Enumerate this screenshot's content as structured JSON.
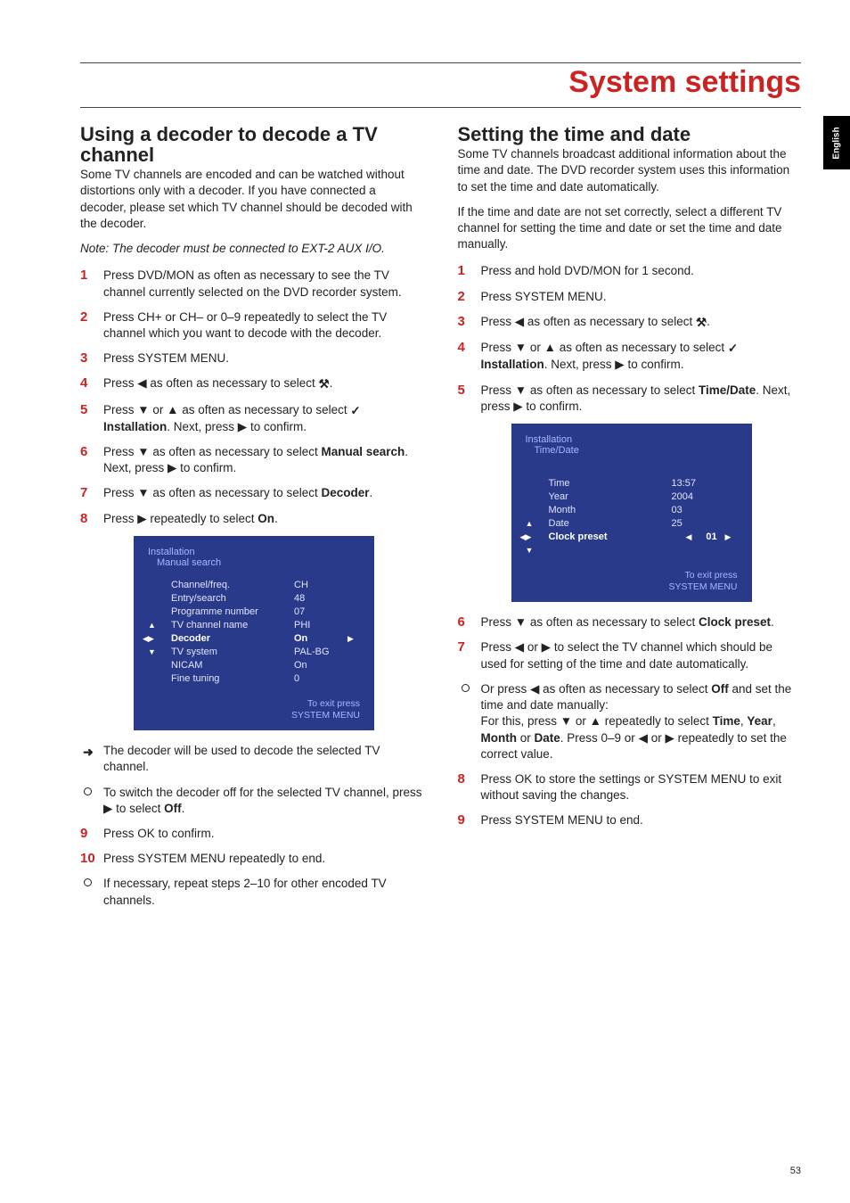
{
  "page": {
    "title": "System settings",
    "language_tab": "English",
    "page_number": "53"
  },
  "glyphs": {
    "left": "◀",
    "right": "▶",
    "up": "▲",
    "down": "▼",
    "arrow_result": "➜",
    "tool": "⚒",
    "wrench": "✓"
  },
  "left": {
    "title": "Using a decoder to decode a TV channel",
    "intro": "Some TV channels are encoded and can be watched without distortions only with a decoder. If you have connected a decoder, please set which TV channel should be decoded with the decoder.",
    "note": "Note: The decoder must be connected to EXT-2 AUX I/O.",
    "steps": {
      "s1": "Press DVD/MON as often as necessary to see the TV channel currently selected on the DVD recorder system.",
      "s2": "Press CH+ or CH– or 0–9 repeatedly to select the TV channel which you want to decode with the decoder.",
      "s3": "Press SYSTEM MENU.",
      "s4a": "Press ",
      "s4b": " as often as necessary to select ",
      "s4c": ".",
      "s5a": "Press ",
      "s5b": " or ",
      "s5c": " as often as necessary to select ",
      "s5d_bold": "Installation",
      "s5e": ". Next, press ",
      "s5f": " to confirm.",
      "s6a": "Press ",
      "s6b": " as often as necessary to select ",
      "s6c_bold": "Manual search",
      "s6d": ". Next, press ",
      "s6e": " to confirm.",
      "s7a": "Press ",
      "s7b": " as often as necessary to select ",
      "s7c_bold": "Decoder",
      "s7d": ".",
      "s8a": "Press ",
      "s8b": " repeatedly to select ",
      "s8c_bold": "On",
      "s8d": ".",
      "s9": "Press OK to confirm.",
      "s10": "Press SYSTEM MENU repeatedly to end."
    },
    "result": "The decoder will be used to decode the selected TV channel.",
    "bullets": {
      "b1a": "To switch the decoder off for the selected TV channel, press ",
      "b1b": " to select ",
      "b1c_bold": "Off",
      "b1d": ".",
      "b2": "If necessary, repeat steps 2–10 for other encoded TV channels."
    },
    "osd": {
      "crumb1": "Installation",
      "crumb2": "Manual search",
      "rows": [
        {
          "label": "Channel/freq.",
          "value": "CH"
        },
        {
          "label": "Entry/search",
          "value": "48"
        },
        {
          "label": "Programme number",
          "value": "07"
        },
        {
          "label": "TV channel name",
          "value": "PHI"
        },
        {
          "label": "Decoder",
          "value": "On",
          "selected": true
        },
        {
          "label": "TV system",
          "value": "PAL-BG"
        },
        {
          "label": "NICAM",
          "value": "On"
        },
        {
          "label": "Fine tuning",
          "value": "0"
        }
      ],
      "footer1": "To exit press",
      "footer2": "SYSTEM MENU"
    }
  },
  "right": {
    "title": "Setting the time and date",
    "intro1": "Some TV channels broadcast additional information about the time and date. The DVD recorder system uses this information to set the time and date automatically.",
    "intro2": "If the time and date are not set correctly, select a different TV channel for setting the time and date or set the time and date manually.",
    "steps": {
      "s1": "Press and hold DVD/MON for 1 second.",
      "s2": "Press SYSTEM MENU.",
      "s3a": "Press ",
      "s3b": " as often as necessary to select ",
      "s3c": ".",
      "s4a": "Press ",
      "s4b": " or ",
      "s4c": " as often as necessary to select ",
      "s4d_bold": "Installation",
      "s4e": ". Next, press ",
      "s4f": " to confirm.",
      "s5a": "Press ",
      "s5b": " as often as necessary to select ",
      "s5c_bold": "Time/Date",
      "s5d": ". Next, press ",
      "s5e": " to confirm.",
      "s6a": "Press ",
      "s6b": " as often as necessary to select ",
      "s6c_bold": "Clock preset",
      "s6d": ".",
      "s7a": "Press ",
      "s7b": " or ",
      "s7c": " to select the TV channel which should be used for setting of the time and date automatically.",
      "b1a": "Or press ",
      "b1b": " as often as necessary to select ",
      "b1c_bold": "Off",
      "b1d": " and set the time and date manually:",
      "b1e": "For this, press ",
      "b1f": " or ",
      "b1g": " repeatedly to select ",
      "b1h_bold1": "Time",
      "b1i": ", ",
      "b1j_bold2": "Year",
      "b1k": ", ",
      "b1l_bold3": "Month",
      "b1m": " or ",
      "b1n_bold4": "Date",
      "b1o": ". Press 0–9 or ",
      "b1p": " or ",
      "b1q": " repeatedly to set the correct value.",
      "s8": "Press OK to store the settings or SYSTEM MENU to exit without saving the changes.",
      "s9": "Press SYSTEM MENU to end."
    },
    "osd": {
      "crumb1": "Installation",
      "crumb2": "Time/Date",
      "rows": [
        {
          "label": "Time",
          "value": "13:57"
        },
        {
          "label": "Year",
          "value": "2004"
        },
        {
          "label": "Month",
          "value": "03"
        },
        {
          "label": "Date",
          "value": "25"
        },
        {
          "label": "Clock preset",
          "value": "01",
          "selected": true
        }
      ],
      "footer1": "To exit press",
      "footer2": "SYSTEM MENU"
    }
  }
}
